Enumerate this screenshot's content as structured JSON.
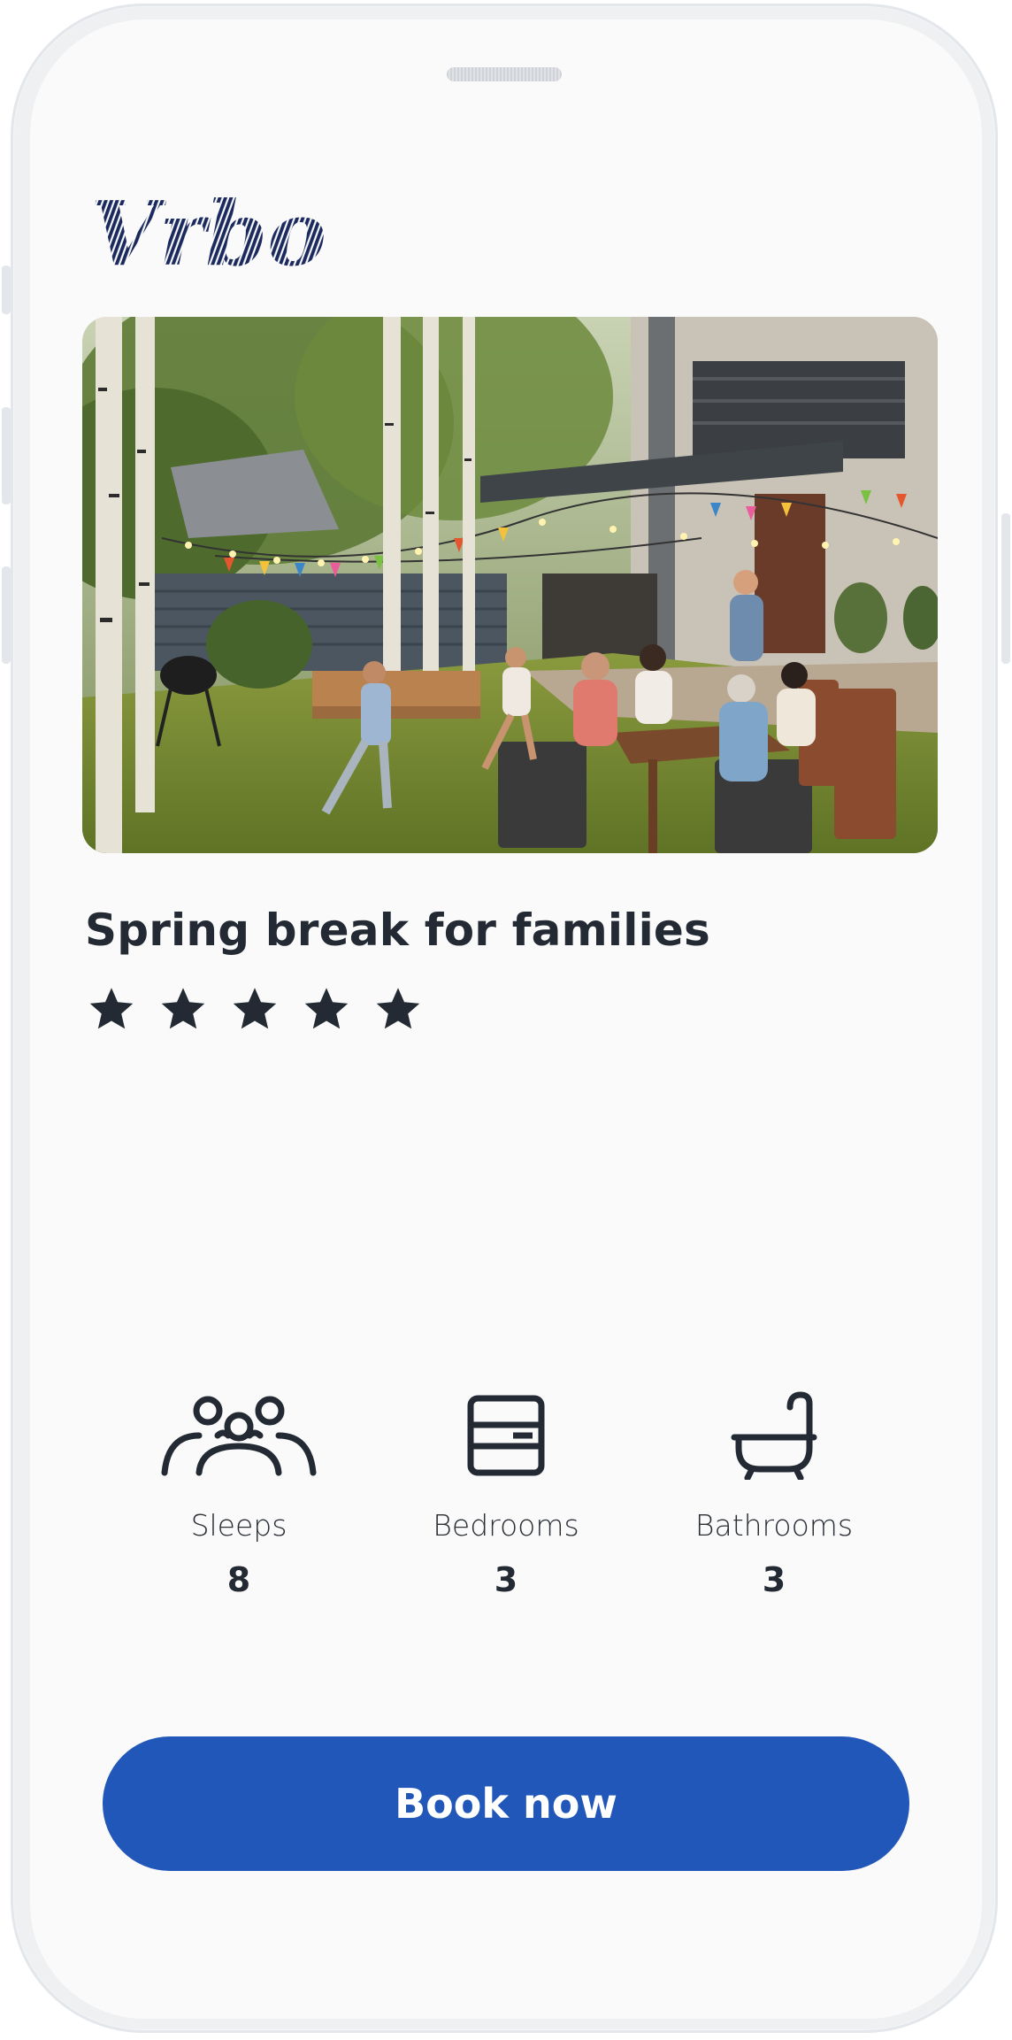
{
  "brand": {
    "logo_text": "Vrbo",
    "logo_color": "#1b2a5e"
  },
  "listing": {
    "image_alt": "Family dinner in a backyard garden with string lights and bunting",
    "title": "Spring break for families",
    "rating": 5,
    "rating_max": 5
  },
  "amenities": [
    {
      "icon": "people-icon",
      "label": "Sleeps",
      "value": "8"
    },
    {
      "icon": "bed-icon",
      "label": "Bedrooms",
      "value": "3"
    },
    {
      "icon": "bathtub-icon",
      "label": "Bathrooms",
      "value": "3"
    }
  ],
  "cta": {
    "label": "Book now",
    "color": "#2157b8"
  },
  "colors": {
    "text": "#232a33",
    "background": "#fafafa"
  }
}
